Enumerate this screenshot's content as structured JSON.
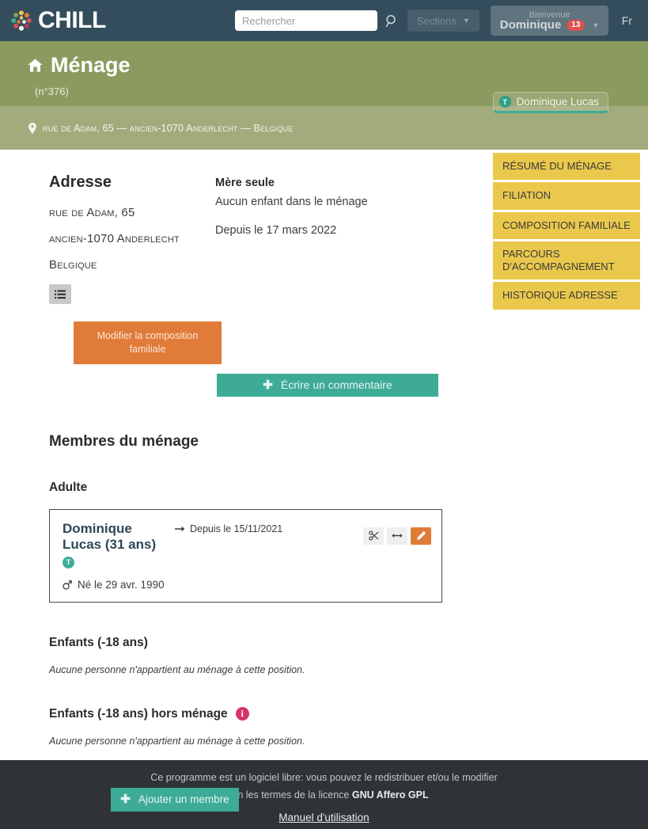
{
  "topnav": {
    "brand": "CHILL",
    "search_placeholder": "Rechercher",
    "search_value": "",
    "sections_label": "Sections",
    "user_welcome": "Bienvenue",
    "user_name": "Dominique",
    "user_badge_count": "13",
    "language": "Fr"
  },
  "banner": {
    "title": "Ménage",
    "subtitle": "(n°376)",
    "person_chip": {
      "initial": "T",
      "name": "Dominique Lucas"
    },
    "address_strip": "rue de Adam, 65 — ancien-1070 Anderlecht — Belgique"
  },
  "sidebar": {
    "items": [
      {
        "label": "RÉSUMÉ DU MÉNAGE"
      },
      {
        "label": "FILIATION"
      },
      {
        "label": "COMPOSITION FAMILIALE"
      },
      {
        "label": "PARCOURS D'ACCOMPAGNEMENT"
      },
      {
        "label": "HISTORIQUE ADRESSE"
      }
    ]
  },
  "address": {
    "heading": "Adresse",
    "line1": "rue de Adam, 65",
    "line2": "ancien-1070 Anderlecht",
    "line3": "Belgique"
  },
  "composition": {
    "title": "Mère seule",
    "children_note": "Aucun enfant dans le ménage",
    "since": "Depuis le 17 mars 2022",
    "edit_button": "Modifier la composition familiale",
    "comment_button": "Écrire un commentaire"
  },
  "members": {
    "heading": "Membres du ménage",
    "adult_heading": "Adulte",
    "card": {
      "name": "Dominique Lucas",
      "age": "(31 ans)",
      "since": "Depuis le 15/11/2021",
      "badge": "T",
      "birth": "Né le 29 avr. 1990"
    },
    "children_heading": "Enfants (-18 ans)",
    "children_empty": "Aucune personne n'appartient au ménage à cette position.",
    "children_out_heading": "Enfants (-18 ans) hors ménage",
    "children_out_empty": "Aucune personne n'appartient au ménage à cette position.",
    "add_button": "Ajouter un membre"
  },
  "footer": {
    "line1": "Ce programme est un logiciel libre: vous pouvez le redistribuer et/ou le modifier",
    "line2_prefix": "selon les termes de la licence ",
    "line2_strong": "GNU Affero GPL",
    "manual_link": "Manuel d'utilisation"
  },
  "colors": {
    "navbar": "#334d5c",
    "banner_green": "#8b9b60",
    "strip_green": "#a2ab7c",
    "sidebar_yellow": "#e9c84c",
    "teal": "#3eab96",
    "orange": "#e07b39",
    "badge_red": "#d9534f",
    "info_pink": "#d6336c",
    "footer_dark": "#2f3337"
  }
}
